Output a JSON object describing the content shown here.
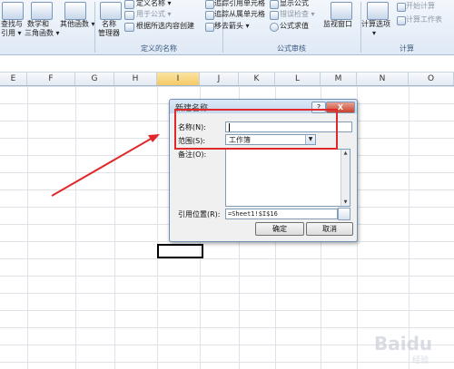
{
  "ribbon": {
    "left_group_items": [
      "查找与",
      "引用",
      "数学和",
      "三角函数",
      "其他函数"
    ],
    "left_row1": "查找与",
    "left_row2": "引用 ▾",
    "math_row1": "数学和",
    "math_row2": "三角函数 ▾",
    "other_label": "其他函数 ▾",
    "name_manager_line1": "名称",
    "name_manager_line2": "管理器",
    "define_name": "定义名称 ▾",
    "use_in_formula": "用于公式 ▾",
    "create_from_selection": "根据所选内容创建",
    "group_defined_names": "定义的名称",
    "trace_precedents": "追踪引用单元格",
    "trace_dependents": "追踪从属单元格",
    "remove_arrows": "移去箭头 ▾",
    "show_formulas": "显示公式",
    "error_checking": "错误检查 ▾",
    "evaluate_formula": "公式求值",
    "group_formula_auditing": "公式审核",
    "watch_window": "监视窗口",
    "calc_options_line1": "计算选项",
    "calc_options_line2": "▾",
    "calc_now": "开始计算",
    "calc_sheet": "计算工作表",
    "group_calculation": "计算"
  },
  "columns": [
    "E",
    "F",
    "G",
    "H",
    "I",
    "J",
    "K",
    "L",
    "M",
    "N",
    "O"
  ],
  "selected_column": "I",
  "dialog": {
    "title": "新建名称",
    "help_label": "?",
    "close_label": "X",
    "name_label": "名称(N):",
    "name_value": "",
    "scope_label": "范围(S):",
    "scope_value": "工作簿",
    "comment_label": "备注(O):",
    "comment_value": "",
    "refers_to_label": "引用位置(R):",
    "refers_to_value": "=Sheet1!$I$16",
    "ok_label": "确定",
    "cancel_label": "取消"
  },
  "colors": {
    "annotation_red": "#e0282a",
    "ribbon_blue": "#dfe9f5",
    "selected_header": "#f5c965"
  },
  "watermark": "Baidu 经验"
}
